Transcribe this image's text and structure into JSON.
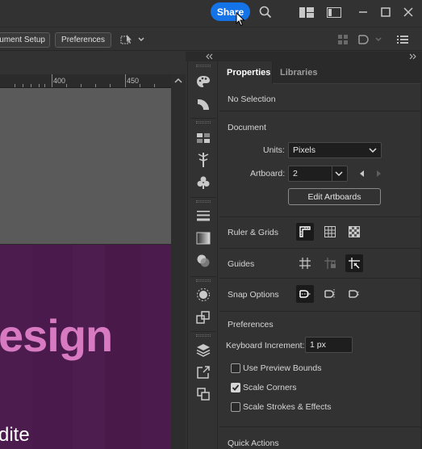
{
  "titlebar": {
    "share_label": "Share",
    "icons": [
      "search-icon",
      "arrange-documents-icon",
      "workspace-switcher-icon",
      "minimize-icon",
      "maximize-icon",
      "close-icon"
    ]
  },
  "controlbar": {
    "document_setup_label": "ument Setup",
    "preferences_label": "Preferences",
    "icons": [
      "select-similar-icon",
      "align-icon",
      "snap-icon",
      "panel-menu-icon"
    ]
  },
  "canvas": {
    "ruler_labels": [
      "400",
      "450"
    ],
    "artboard_title": "esign",
    "artboard_subtitle": "dite",
    "artboard_color": "#4a1a4c",
    "title_color": "#d77ac2"
  },
  "dock": {
    "icons": [
      "color-icon",
      "color-guide-icon",
      "swatches-icon",
      "brushes-icon",
      "symbols-icon",
      "stroke-icon",
      "gradient-icon",
      "transparency-icon",
      "appearance-icon",
      "transform-icon",
      "layers-icon",
      "export-icon",
      "artboards-icon"
    ]
  },
  "panel": {
    "tabs": [
      "Properties",
      "Libraries"
    ],
    "selection_status": "No Selection",
    "document": {
      "heading": "Document",
      "units_label": "Units:",
      "units_value": "Pixels",
      "artboard_label": "Artboard:",
      "artboard_value": "2",
      "edit_artboards_label": "Edit Artboards"
    },
    "ruler_grids_label": "Ruler & Grids",
    "guides_label": "Guides",
    "snap_options_label": "Snap Options",
    "preferences": {
      "heading": "Preferences",
      "keyboard_increment_label": "Keyboard Increment:",
      "keyboard_increment_value": "1 px",
      "use_preview_bounds_label": "Use Preview Bounds",
      "use_preview_bounds_checked": false,
      "scale_corners_label": "Scale Corners",
      "scale_corners_checked": true,
      "scale_strokes_label": "Scale Strokes & Effects",
      "scale_strokes_checked": false
    },
    "quick_actions_label": "Quick Actions"
  }
}
